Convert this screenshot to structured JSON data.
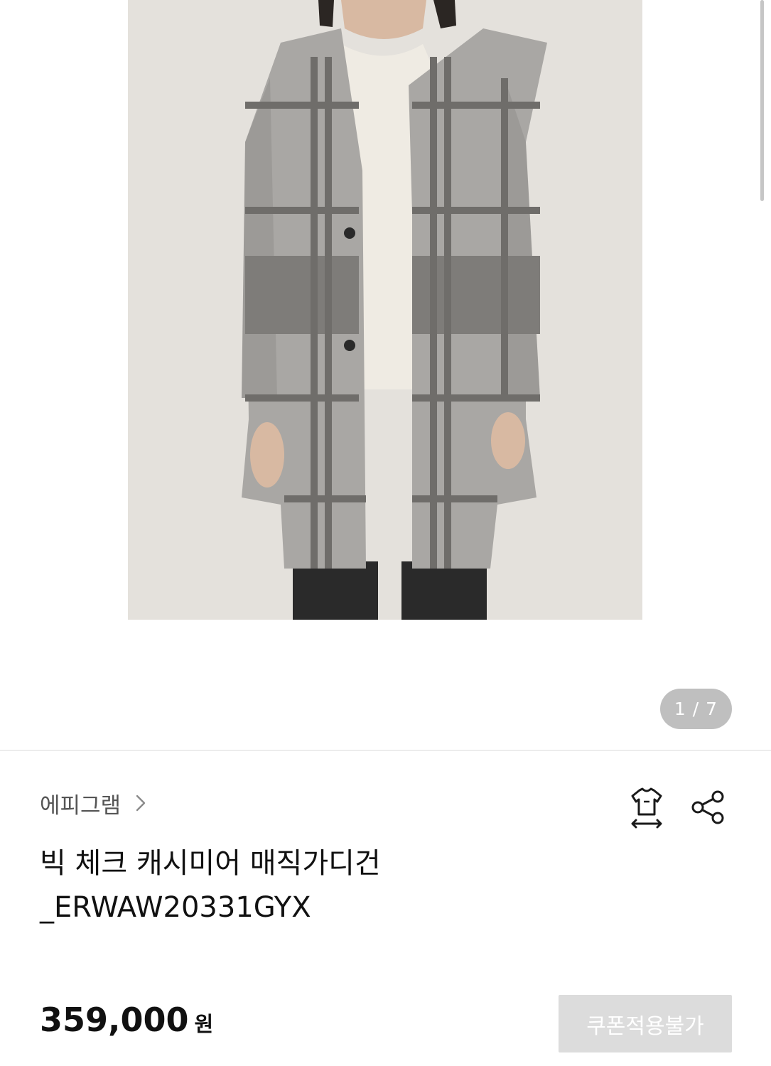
{
  "gallery": {
    "image_description_icon": "product-photo",
    "counter": "1 / 7"
  },
  "product": {
    "brand": "에피그램",
    "title_line1": "빅 체크 캐시미어 매직가디건",
    "title_line2": "_ERWAW20331GYX",
    "price": "359,000",
    "currency": "원"
  },
  "actions": {
    "size_icon": "tshirt-size-icon",
    "share_icon": "share-icon",
    "coupon_label": "쿠폰적용불가"
  },
  "colors": {
    "coupon_disabled_bg": "#dcdcdc",
    "counter_bg": "#bfbfbf"
  }
}
